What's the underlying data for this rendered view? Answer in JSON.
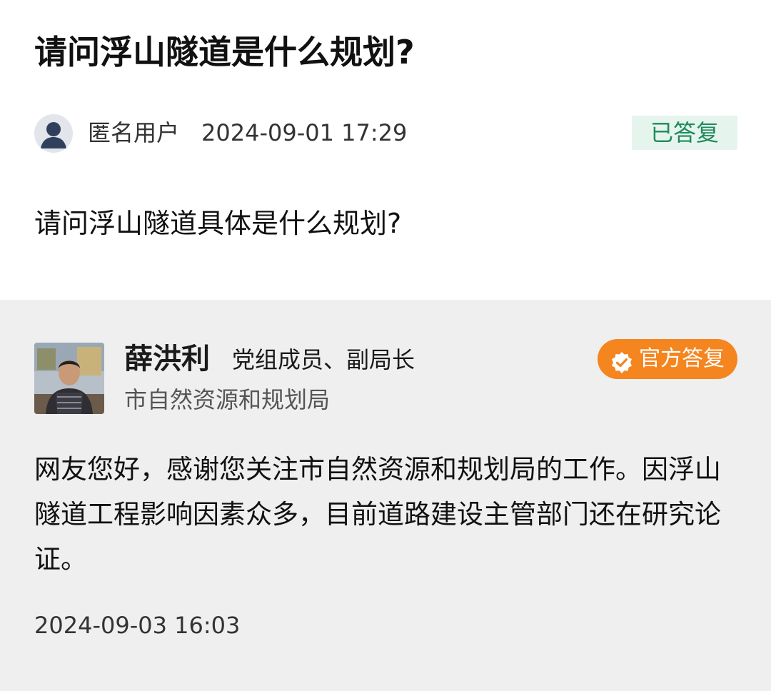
{
  "question": {
    "title": "请问浮山隧道是什么规划?",
    "asker_name": "匿名用户",
    "asked_at": "2024-09-01 17:29",
    "status": "已答复",
    "body": "请问浮山隧道具体是什么规划?"
  },
  "answer": {
    "responder_name": "薛洪利",
    "responder_title": "党组成员、副局长",
    "department": "市自然资源和规划局",
    "badge_label": "官方答复",
    "badge_icon": "verified-check-icon",
    "text": "网友您好，感谢您关注市自然资源和规划局的工作。因浮山隧道工程影响因素众多，目前道路建设主管部门还在研究论证。",
    "replied_at": "2024-09-03 16:03"
  },
  "colors": {
    "status_text": "#1e8a5b",
    "status_bg": "#e6f4ee",
    "official_badge_bg": "#f4851f",
    "answer_bg": "#efefef"
  }
}
